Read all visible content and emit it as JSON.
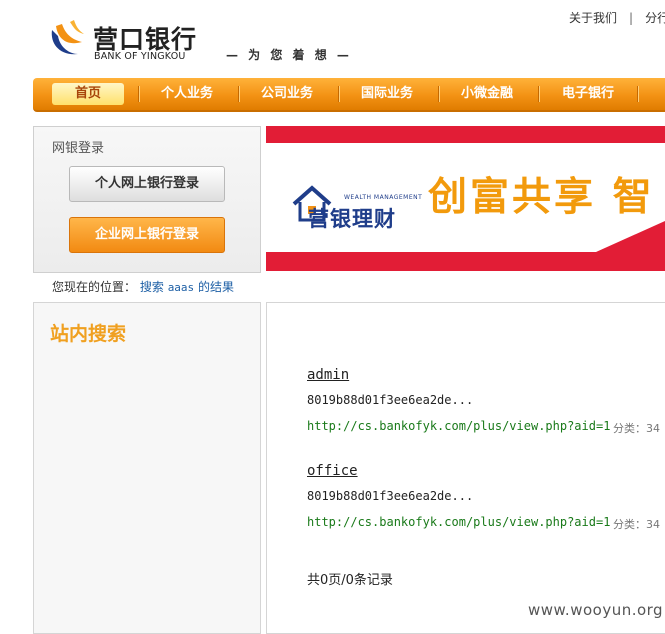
{
  "header": {
    "logo_cn": "营口银行",
    "logo_en": "BANK OF YINGKOU",
    "slogan": "— 为 您 着 想 —",
    "top_links": [
      "关于我们",
      "分行"
    ]
  },
  "nav": {
    "items": [
      "首页",
      "个人业务",
      "公司业务",
      "国际业务",
      "小微金融",
      "电子银行"
    ],
    "active": "首页"
  },
  "login": {
    "title": "网银登录",
    "personal_button": "个人网上银行登录",
    "corporate_button": "企业网上银行登录"
  },
  "banner": {
    "small_text": "WEALTH MANAGEMENT",
    "brand": "营银理财",
    "slogan": "创富共享 智"
  },
  "breadcrumb": {
    "prefix": "您现在的位置：",
    "link": "搜索",
    "keyword": "aaas",
    "suffix": "的结果"
  },
  "sidebar": {
    "title": "站内搜索"
  },
  "results": {
    "items": [
      {
        "title": "admin",
        "desc": "8019b88d01f3ee6ea2de...",
        "url": "http://cs.bankofyk.com/plus/view.php?aid=1",
        "category": "分类：34"
      },
      {
        "title": "office",
        "desc": "8019b88d01f3ee6ea2de...",
        "url": "http://cs.bankofyk.com/plus/view.php?aid=1",
        "category": "分类：34"
      }
    ],
    "summary": "共0页/0条记录"
  },
  "watermark": "www.wooyun.org",
  "colors": {
    "nav_orange": "#f39214",
    "banner_red": "#e21d36",
    "slogan_orange": "#f29a0c",
    "brand_blue": "#1f3d8a",
    "url_green": "#1a7a1a"
  }
}
